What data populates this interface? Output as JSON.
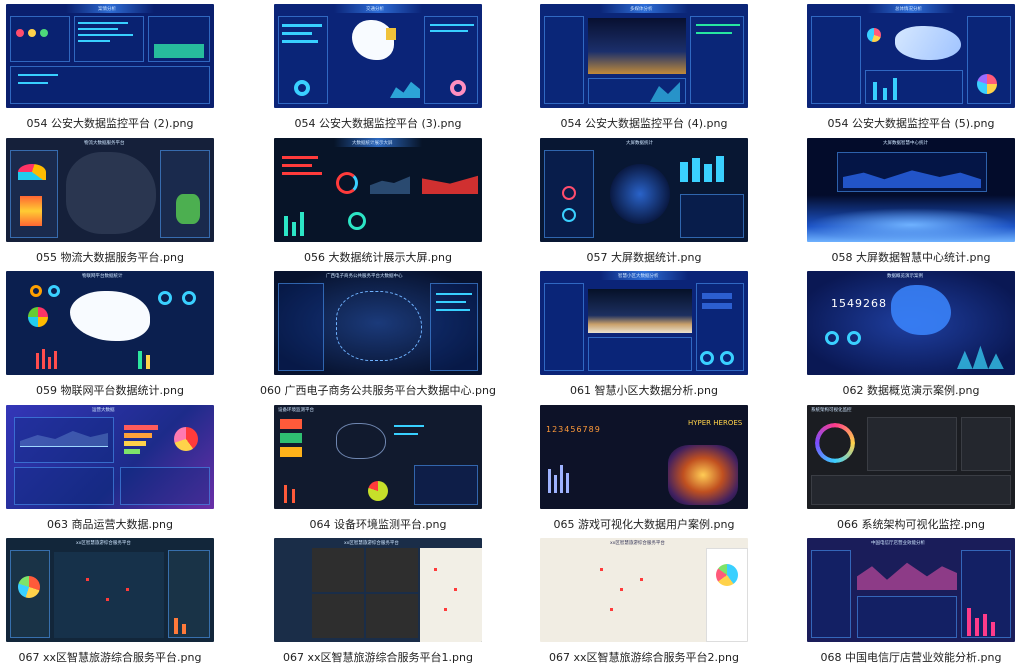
{
  "items": [
    {
      "caption": "054 公安大数据监控平台 (2).png",
      "title": "案情分析"
    },
    {
      "caption": "054 公安大数据监控平台 (3).png",
      "title": "交通分析"
    },
    {
      "caption": "054 公安大数据监控平台 (4).png",
      "title": "多媒体分析"
    },
    {
      "caption": "054 公安大数据监控平台 (5).png",
      "title": "总体情况分析"
    },
    {
      "caption": "055 物流大数据服务平台.png",
      "title": "物流大数据服务平台"
    },
    {
      "caption": "056 大数据统计展示大屏.png",
      "title": "大数据统计展示大屏"
    },
    {
      "caption": "057 大屏数据统计.png",
      "title": "大屏数据统计"
    },
    {
      "caption": "058 大屏数据智慧中心统计.png",
      "title": "大屏数据智慧中心统计"
    },
    {
      "caption": "059 物联网平台数据统计.png",
      "title": "物联网平台数据统计"
    },
    {
      "caption": "060 广西电子商务公共服务平台大数据中心.png",
      "title": "广西电子商务公共服务平台大数据中心"
    },
    {
      "caption": "061 智慧小区大数据分析.png",
      "title": "智慧小区大数据分析"
    },
    {
      "caption": "062 数据概览演示案例.png",
      "title": "数据概览演示案例",
      "bignum": "1549268"
    },
    {
      "caption": "063 商品运营大数据.png",
      "title": "运营大数据"
    },
    {
      "caption": "064 设备环境监测平台.png",
      "title": "设备环境监测平台"
    },
    {
      "caption": "065 游戏可视化大数据用户案例.png",
      "title": "HYPER HEROES",
      "bignum": "123456789"
    },
    {
      "caption": "066 系统架构可视化监控.png",
      "title": "系统架构可视化监控"
    },
    {
      "caption": "067 xx区智慧旅游综合服务平台.png",
      "title": "xx区智慧旅游综合服务平台"
    },
    {
      "caption": "067 xx区智慧旅游综合服务平台1.png",
      "title": "xx区智慧旅游综合服务平台"
    },
    {
      "caption": "067 xx区智慧旅游综合服务平台2.png",
      "title": "xx区智慧旅游综合服务平台"
    },
    {
      "caption": "068 中国电信厅店营业效能分析.png",
      "title": "中国电信厅店营业效能分析"
    }
  ]
}
